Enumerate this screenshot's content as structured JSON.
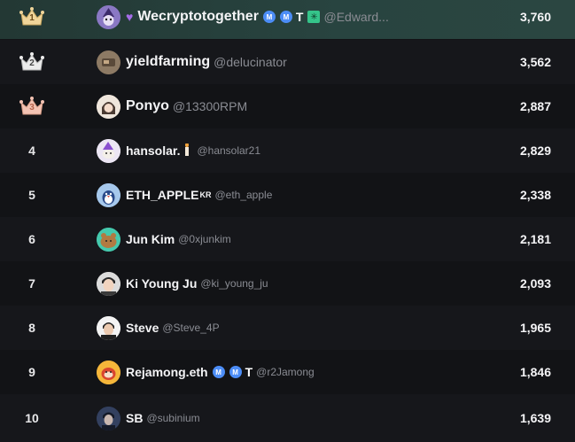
{
  "leaderboard": {
    "rows": [
      {
        "rank": "1",
        "name": "Wecryptotogether",
        "handle": "@Edward...",
        "score": "3,760",
        "badges": [
          "M",
          "M",
          "T",
          "✳"
        ]
      },
      {
        "rank": "2",
        "name": "yieldfarming",
        "handle": "@delucinator",
        "score": "3,562"
      },
      {
        "rank": "3",
        "name": "Ponyo",
        "handle": "@13300RPM",
        "score": "2,887"
      },
      {
        "rank": "4",
        "name": "hansolar.",
        "handle": "@hansolar21",
        "score": "2,829"
      },
      {
        "rank": "5",
        "name": "ETH_APPLE",
        "name_suffix": "KR",
        "handle": "@eth_apple",
        "score": "2,338"
      },
      {
        "rank": "6",
        "name": "Jun Kim",
        "handle": "@0xjunkim",
        "score": "2,181"
      },
      {
        "rank": "7",
        "name": "Ki Young Ju",
        "handle": "@ki_young_ju",
        "score": "2,093"
      },
      {
        "rank": "8",
        "name": "Steve",
        "handle": "@Steve_4P",
        "score": "1,965"
      },
      {
        "rank": "9",
        "name": "Rejamong.eth",
        "handle": "@r2Jamong",
        "score": "1,846",
        "badges": [
          "M",
          "M",
          "T"
        ]
      },
      {
        "rank": "10",
        "name": "SB",
        "handle": "@subinium",
        "score": "1,639"
      }
    ]
  },
  "colors": {
    "gold": "#f0d59a",
    "silver": "#ececec",
    "bronze": "#f3c3b3",
    "badge_blue": "#4c8df6",
    "badge_green": "#35c48a",
    "highlight_row": "#284440"
  },
  "icons": {
    "rank_1": "crown-gold-icon",
    "rank_2": "crown-silver-icon",
    "rank_3": "crown-bronze-icon",
    "heart": "purple-heart-icon",
    "candle": "candle-icon"
  }
}
